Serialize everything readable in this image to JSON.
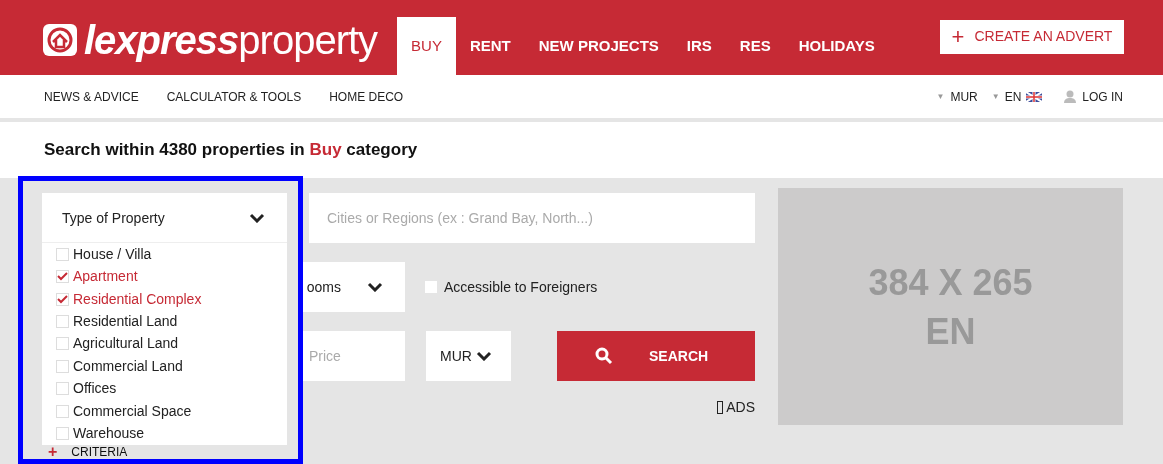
{
  "header": {
    "logo": {
      "bold": "lexpress",
      "light": "property"
    },
    "nav": [
      {
        "label": "BUY",
        "selected": true
      },
      {
        "label": "RENT",
        "selected": false
      },
      {
        "label": "NEW PROJECTS",
        "selected": false
      },
      {
        "label": "IRS",
        "selected": false
      },
      {
        "label": "RES",
        "selected": false
      },
      {
        "label": "HOLIDAYS",
        "selected": false
      }
    ],
    "create_button": {
      "icon": "+",
      "label": "CREATE AN ADVERT"
    }
  },
  "subnav": {
    "caret": "▼",
    "links": [
      "NEWS & ADVICE",
      "CALCULATOR & TOOLS",
      "HOME DECO"
    ],
    "currency": "MUR",
    "language": "EN",
    "login": "LOG IN"
  },
  "heading": "Search within 4380 properties in **Buy** category",
  "search": {
    "type_select": {
      "label": "Type of Property",
      "expanded": true,
      "options": [
        {
          "label": "House / Villa",
          "checked": false
        },
        {
          "label": "Apartment",
          "checked": true
        },
        {
          "label": "Residential Complex",
          "checked": true
        },
        {
          "label": "Residential Land",
          "checked": false
        },
        {
          "label": "Agricultural Land",
          "checked": false
        },
        {
          "label": "Commercial Land",
          "checked": false
        },
        {
          "label": "Offices",
          "checked": false
        },
        {
          "label": "Commercial Space",
          "checked": false
        },
        {
          "label": "Warehouse",
          "checked": false
        }
      ]
    },
    "location": {
      "placeholder": "Cities or Regions (ex : Grand Bay, North...)"
    },
    "bedrooms": {
      "value": "ooms"
    },
    "foreigners": {
      "label": "Accessible to Foreigners",
      "checked": false
    },
    "price": {
      "placeholder": "Price"
    },
    "currency": {
      "value": "MUR"
    },
    "search_button": "SEARCH",
    "ads": "ADS",
    "criteria": {
      "icon": "+",
      "label": "CRITERIA"
    }
  },
  "ad": {
    "lines": [
      "384 X 265",
      "EN"
    ]
  }
}
